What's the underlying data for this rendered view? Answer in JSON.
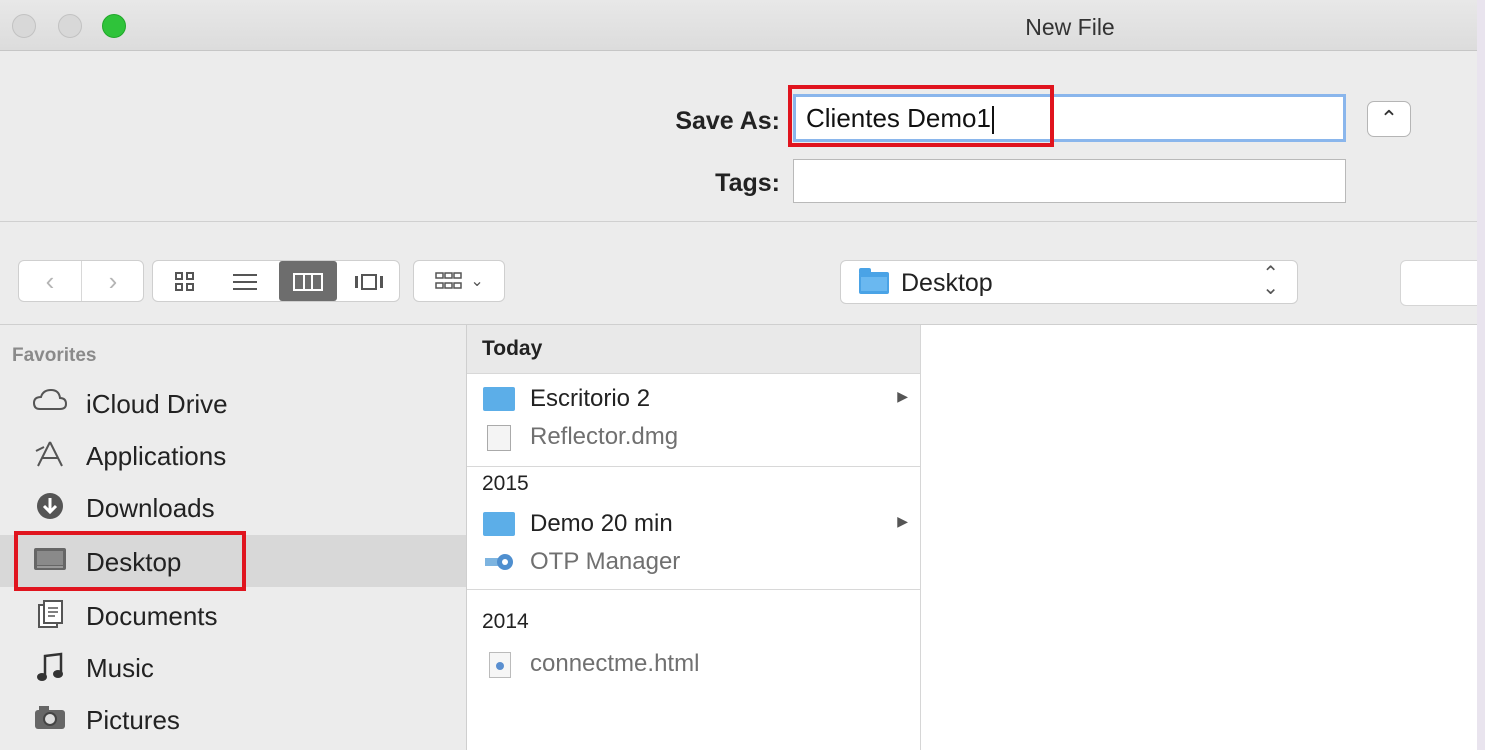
{
  "window": {
    "title": "New File"
  },
  "form": {
    "save_as_label": "Save As:",
    "save_as_value": "Clientes Demo1",
    "tags_label": "Tags:",
    "tags_value": "",
    "disclosure_icon": "chevron-up-icon"
  },
  "toolbar": {
    "back_icon": "chevron-left-icon",
    "forward_icon": "chevron-right-icon",
    "view_modes": [
      "icon-view-icon",
      "list-view-icon",
      "column-view-icon",
      "cover-flow-icon"
    ],
    "active_view": "column-view-icon",
    "arrange_icon": "arrange-grid-icon",
    "location": "Desktop"
  },
  "sidebar": {
    "heading": "Favorites",
    "items": [
      {
        "label": "iCloud Drive",
        "icon": "cloud-icon"
      },
      {
        "label": "Applications",
        "icon": "applications-icon"
      },
      {
        "label": "Downloads",
        "icon": "download-icon"
      },
      {
        "label": "Desktop",
        "icon": "desktop-icon",
        "selected": true
      },
      {
        "label": "Documents",
        "icon": "documents-icon"
      },
      {
        "label": "Music",
        "icon": "music-note-icon"
      },
      {
        "label": "Pictures",
        "icon": "camera-icon"
      }
    ]
  },
  "files": {
    "groups": [
      {
        "heading": "Today",
        "items": [
          {
            "name": "Escritorio 2",
            "kind": "folder",
            "has_children": true
          },
          {
            "name": "Reflector.dmg",
            "kind": "disk-image",
            "dimmed": true
          }
        ]
      },
      {
        "heading": "2015",
        "items": [
          {
            "name": "Demo 20 min",
            "kind": "folder",
            "has_children": true
          },
          {
            "name": "OTP Manager",
            "kind": "app",
            "dimmed": true
          }
        ]
      },
      {
        "heading": "2014",
        "items": [
          {
            "name": "connectme.html",
            "kind": "html-file",
            "dimmed": true
          }
        ]
      }
    ]
  },
  "highlight_color": "#e0141e"
}
